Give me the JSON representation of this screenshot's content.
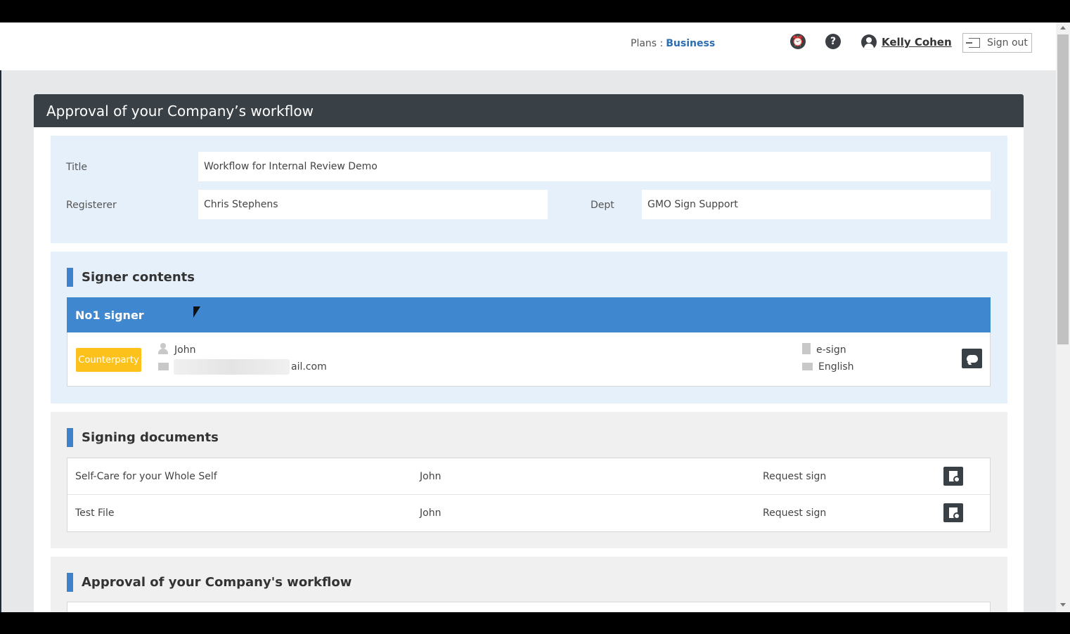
{
  "header": {
    "plans_label": "Plans :",
    "plan_value": "Business",
    "alarm_icon": "alarm-clock-icon",
    "help_icon": "?",
    "user_name": "Kelly Cohen",
    "signout_label": "Sign out"
  },
  "panel": {
    "title": "Approval of your Company’s workflow"
  },
  "info": {
    "title_label": "Title",
    "title_value": "Workflow for Internal Review Demo",
    "registerer_label": "Registerer",
    "registerer_value": "Chris Stephens",
    "dept_label": "Dept",
    "dept_value": "GMO Sign Support"
  },
  "signer": {
    "section_title": "Signer contents",
    "header": "No1 signer",
    "badge": "Counterparty",
    "name": "John",
    "email_prefix": "l",
    "email_suffix": "ail.com",
    "sign_type": "e-sign",
    "language": "English"
  },
  "documents": {
    "section_title": "Signing documents",
    "rows": [
      {
        "name": "Self-Care for your Whole Self",
        "signer": "John",
        "action": "Request sign"
      },
      {
        "name": "Test File",
        "signer": "John",
        "action": "Request sign"
      }
    ]
  },
  "approval": {
    "section_title": "Approval of your Company's workflow"
  },
  "colors": {
    "accent_blue": "#3f88cf",
    "badge_yellow": "#fcc21b",
    "panel_header": "#3a4146",
    "plan_link": "#2a6db3"
  }
}
